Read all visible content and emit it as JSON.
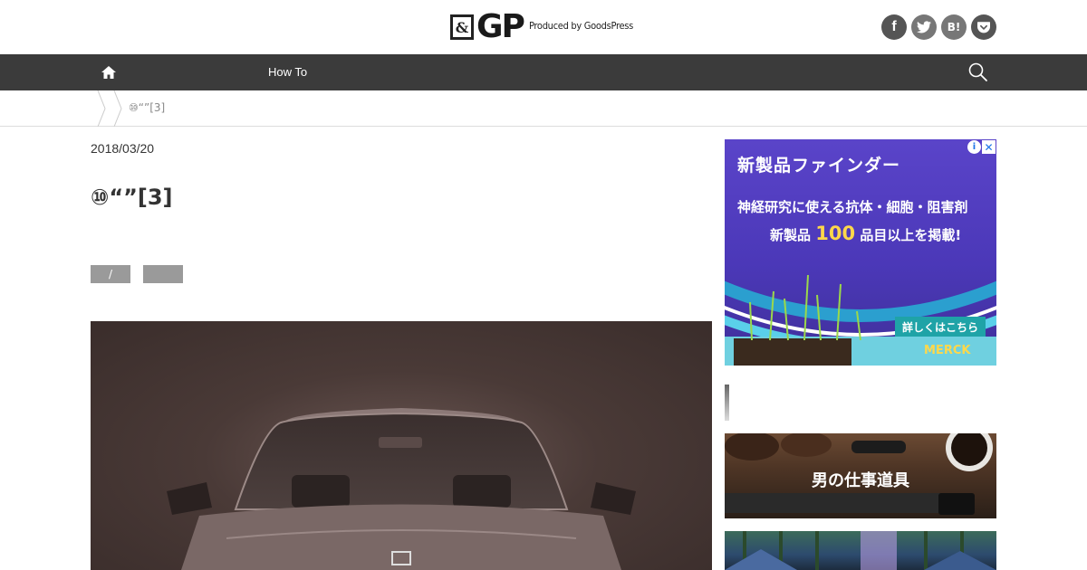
{
  "header": {
    "logo_mark": "&",
    "logo_text": "GP",
    "logo_sub": "Produced by GoodsPress",
    "social": [
      {
        "name": "facebook",
        "glyph": "f"
      },
      {
        "name": "twitter",
        "glyph": "t"
      },
      {
        "name": "hatena",
        "glyph": "B!"
      },
      {
        "name": "pocket",
        "glyph": "✓"
      }
    ]
  },
  "nav": {
    "link": "How To"
  },
  "breadcrumb": {
    "current": "⑩“”[3]"
  },
  "article": {
    "date": "2018/03/20",
    "title": "⑩“”[3]",
    "tags": [
      "/",
      ""
    ]
  },
  "sidebar": {
    "ad": {
      "headline": "新製品ファインダー",
      "line2": "神経研究に使える抗体・細胞・阻害剤",
      "line3_pre": "新製品",
      "line3_num": "100",
      "line3_post": "品目以上を掲載!",
      "cta": "詳しくはこちら",
      "brand": "MERCK"
    },
    "banner1_text": "男の仕事道具"
  },
  "colors": {
    "navbar": "#3b3b3b",
    "tag": "#9a9a9a",
    "ad_bg": "#5a44c9"
  }
}
